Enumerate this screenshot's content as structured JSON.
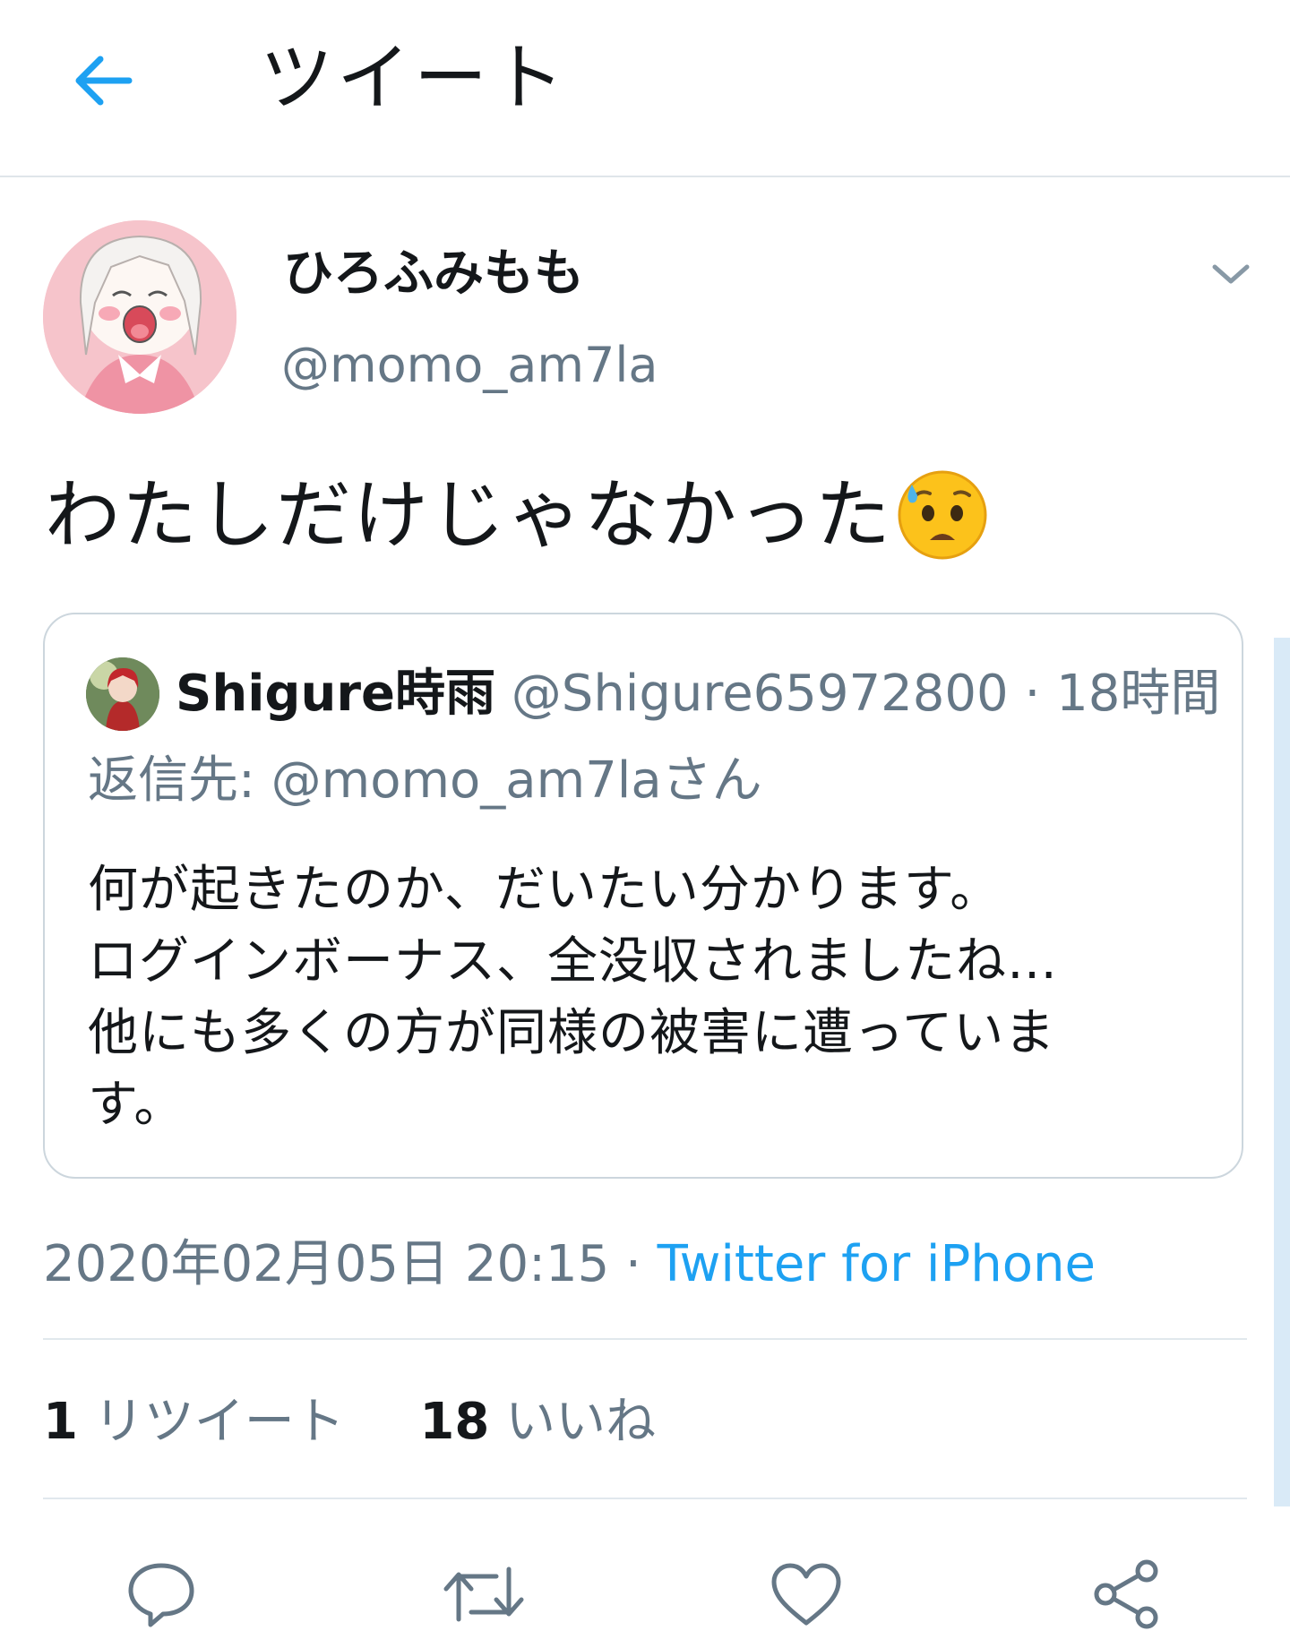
{
  "header": {
    "title": "ツイート",
    "back_icon": "arrow-left-icon"
  },
  "author": {
    "name": "ひろふみもも",
    "handle": "@momo_am7la",
    "menu_icon": "chevron-down-icon"
  },
  "tweet": {
    "text": "わたしだけじゃなかった",
    "emoji": "anxious-face-with-sweat-emoji"
  },
  "quote": {
    "name": "Shigure時雨",
    "handle": "@Shigure65972800",
    "separator": " · ",
    "time": "18時間",
    "reply_to": "返信先: @momo_am7laさん",
    "body_lines": [
      "何が起きたのか、だいたい分かります。",
      "ログインボーナス、全没収されましたね…",
      "他にも多くの方が同様の被害に遭っていま",
      "す。"
    ]
  },
  "meta": {
    "timestamp": "2020年02月05日 20:15",
    "separator": " · ",
    "source": "Twitter for iPhone"
  },
  "stats": {
    "retweets_count": "1",
    "retweets_label": "リツイート",
    "likes_count": "18",
    "likes_label": "いいね"
  },
  "actions": [
    "reply-icon",
    "retweet-icon",
    "like-icon",
    "share-icon"
  ],
  "colors": {
    "accent": "#1da1f2",
    "secondary_text": "#657786",
    "border": "#ccd6dd"
  }
}
